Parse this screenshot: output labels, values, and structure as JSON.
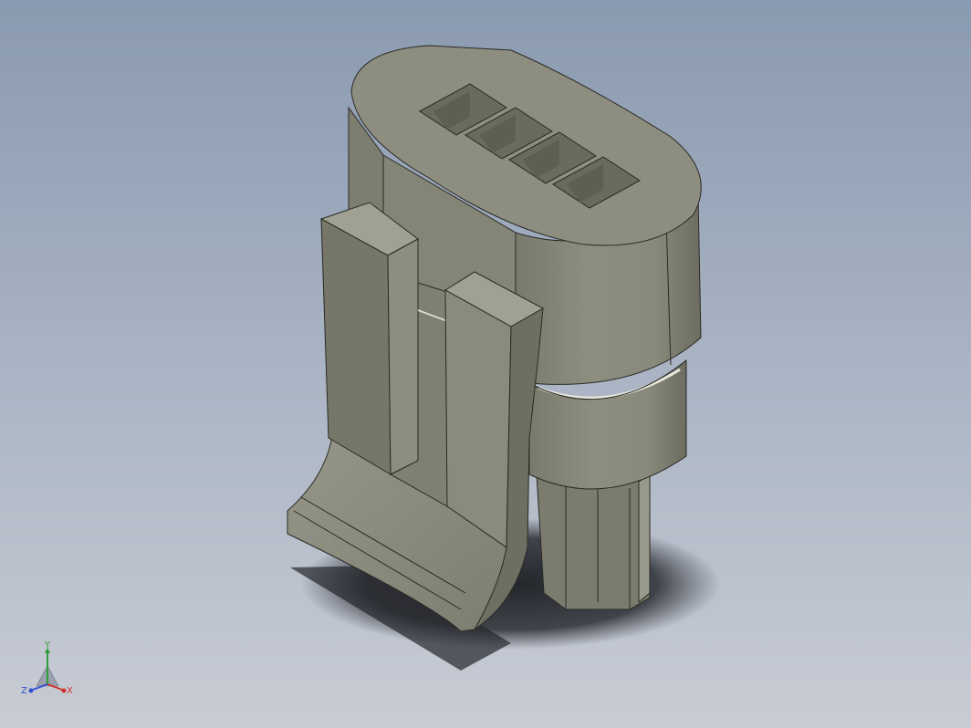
{
  "viewport": {
    "background_top": "#8a9ab0",
    "background_bottom": "#c8ccd4"
  },
  "model": {
    "part": "connector-housing",
    "body_color": "#8a8a7c",
    "shade_color": "#6f6f63",
    "highlight_color": "#a9a99a"
  },
  "triad": {
    "x_label": "X",
    "y_label": "Y",
    "z_label": "Z",
    "x_color": "#d0342c",
    "y_color": "#2e9e3a",
    "z_color": "#2f4fd1"
  }
}
